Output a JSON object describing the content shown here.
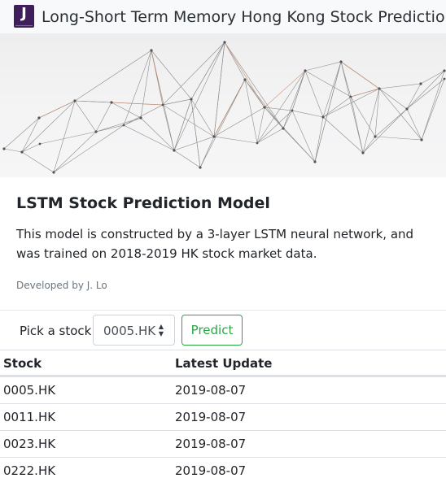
{
  "navbar": {
    "logo_letter": "J",
    "title": "Long-Short Term Memory Hong Kong Stock Prediction"
  },
  "card": {
    "title": "LSTM Stock Prediction Model",
    "text": "This model is constructed by a 3-layer LSTM neural network, and was trained on 2018-2019 HK stock market data.",
    "footnote": "Developed by J. Lo"
  },
  "form": {
    "label": "Pick a stock",
    "selected_stock": "0005.HK",
    "predict_label": "Predict"
  },
  "table": {
    "headers": [
      "Stock",
      "Latest Update"
    ],
    "rows": [
      [
        "0005.HK",
        "2019-08-07"
      ],
      [
        "0011.HK",
        "2019-08-07"
      ],
      [
        "0023.HK",
        "2019-08-07"
      ],
      [
        "0222.HK",
        "2019-08-07"
      ]
    ]
  },
  "colors": {
    "logo_background": "#3e1f5c",
    "predict_accent": "#28a745",
    "network_lines": "#555555",
    "network_highlight": "#c98a6a"
  },
  "icons": {
    "select_arrows": "up-down-caret-icon"
  }
}
